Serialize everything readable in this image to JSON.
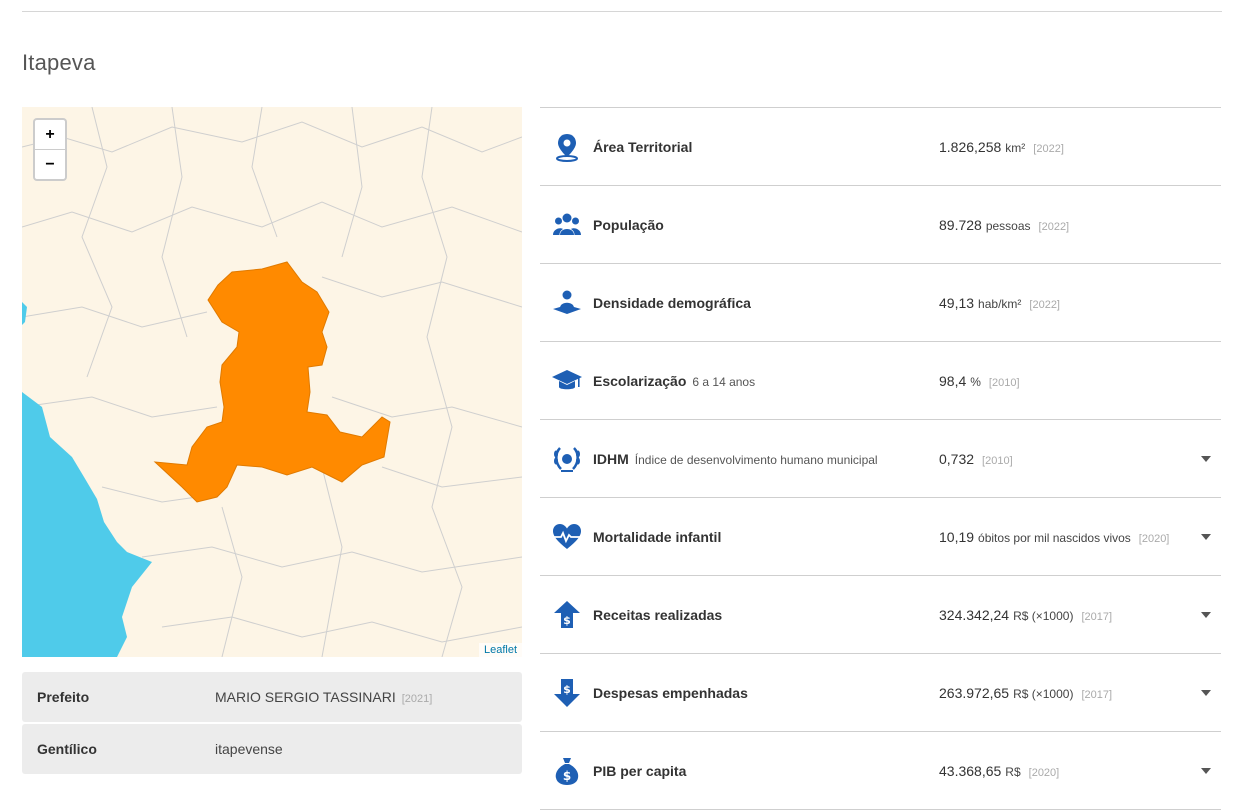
{
  "page": {
    "title": "Itapeva"
  },
  "map": {
    "zoom_in_label": "+",
    "zoom_out_label": "−",
    "attribution": "Leaflet",
    "colors": {
      "land": "#fdf5e6",
      "water": "#4fcbea",
      "highlight": "#ff8a00",
      "border": "#cccccc"
    }
  },
  "info": [
    {
      "label": "Prefeito",
      "value": "MARIO SERGIO TASSINARI",
      "year": "[2021]"
    },
    {
      "label": "Gentílico",
      "value": "itapevense",
      "year": ""
    }
  ],
  "indicators": [
    {
      "icon": "map-pin-icon",
      "name": "Área Territorial",
      "sub": "",
      "value": "1.826,258",
      "unit": "km²",
      "year": "[2022]",
      "expandable": false
    },
    {
      "icon": "people-icon",
      "name": "População",
      "sub": "",
      "value": "89.728",
      "unit": "pessoas",
      "year": "[2022]",
      "expandable": false
    },
    {
      "icon": "person-area-icon",
      "name": "Densidade demográfica",
      "sub": "",
      "value": "49,13",
      "unit": "hab/km²",
      "year": "[2022]",
      "expandable": false
    },
    {
      "icon": "graduation-cap-icon",
      "name": "Escolarização",
      "sub": "6 a 14 anos",
      "value": "98,4",
      "unit": "%",
      "year": "[2010]",
      "expandable": false
    },
    {
      "icon": "laurel-icon",
      "name": "IDHM",
      "sub": "Índice de desenvolvimento humano municipal",
      "value": "0,732",
      "unit": "",
      "year": "[2010]",
      "expandable": true
    },
    {
      "icon": "heartbeat-icon",
      "name": "Mortalidade infantil",
      "sub": "",
      "value": "10,19",
      "unit": "óbitos por mil nascidos vivos",
      "year": "[2020]",
      "expandable": true
    },
    {
      "icon": "revenue-up-icon",
      "name": "Receitas realizadas",
      "sub": "",
      "value": "324.342,24",
      "unit": "R$ (×1000)",
      "year": "[2017]",
      "expandable": true
    },
    {
      "icon": "expense-down-icon",
      "name": "Despesas empenhadas",
      "sub": "",
      "value": "263.972,65",
      "unit": "R$ (×1000)",
      "year": "[2017]",
      "expandable": true
    },
    {
      "icon": "money-bag-icon",
      "name": "PIB per capita",
      "sub": "",
      "value": "43.368,65",
      "unit": "R$",
      "year": "[2020]",
      "expandable": true
    }
  ],
  "accent": "#1e5fb4"
}
